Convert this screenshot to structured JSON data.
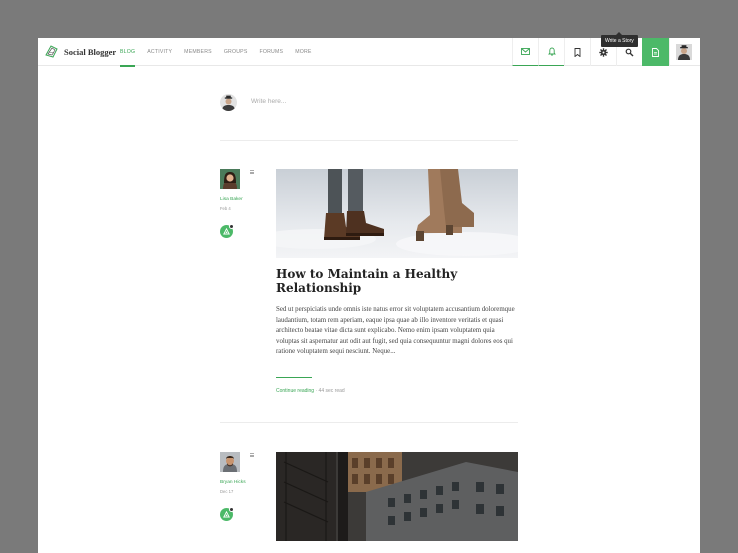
{
  "app": {
    "name": "Social Blogger"
  },
  "nav": {
    "items": [
      "BLOG",
      "ACTIVITY",
      "MEMBERS",
      "GROUPS",
      "FORUMS",
      "MORE"
    ],
    "active": "BLOG"
  },
  "actions": {
    "tooltip": "Write a Story"
  },
  "colors": {
    "accent": "#3aa655",
    "accent_button": "#4cb968",
    "backdrop": "#7a7a7a"
  },
  "composer": {
    "placeholder": "Write here..."
  },
  "posts": [
    {
      "author": "Lisa Baker",
      "date": "Feb 4",
      "title": "How to Maintain a Healthy Relationship",
      "excerpt": "Sed ut perspiciatis unde omnis iste natus error sit voluptatem accusantium doloremque laudantium, totam rem aperiam, eaque ipsa quae ab illo inventore veritatis et quasi architecto beatae vitae dicta sunt explicabo. Nemo enim ipsam voluptatem quia voluptas sit aspernatur aut odit aut fugit, sed quia consequuntur magni dolores eos qui ratione voluptatem sequi nesciunt. Neque...",
      "link": "Continue reading",
      "separator": "·",
      "read_time": "44 sec read"
    },
    {
      "author": "Bryan Hicks",
      "date": "Dec 17"
    }
  ]
}
